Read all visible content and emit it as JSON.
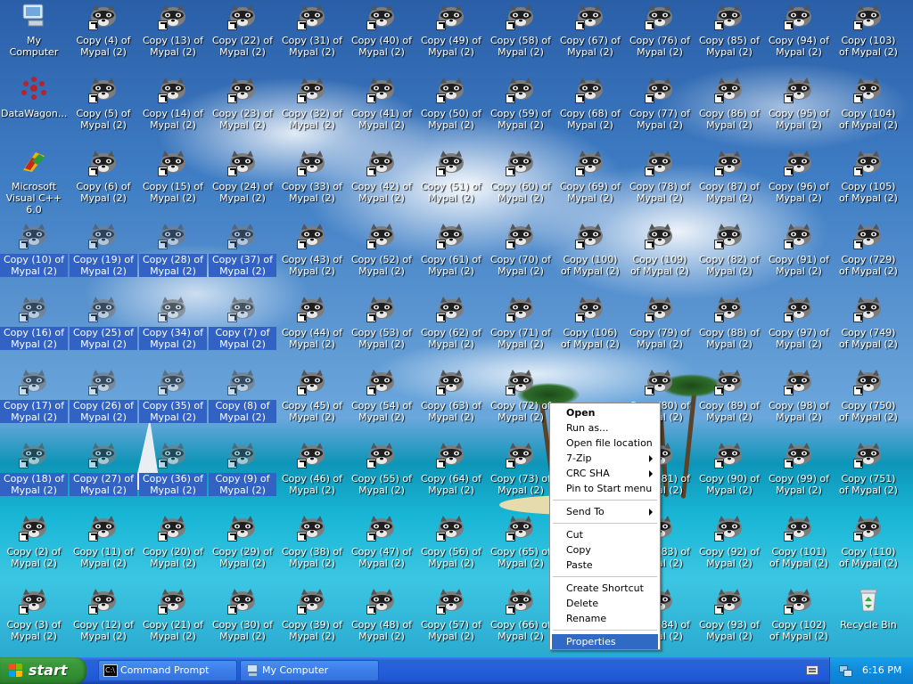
{
  "desktop": {
    "special_icons": [
      {
        "id": "my-computer",
        "label": "My Computer",
        "icon": "my-computer-icon"
      },
      {
        "id": "datawagon",
        "label": "DataWagon...",
        "icon": "datawagon-icon"
      },
      {
        "id": "msvc",
        "label": "Microsoft Visual C++ 6.0",
        "icon": "visual-cpp-icon"
      },
      {
        "id": "recycle-bin",
        "label": "Recycle Bin",
        "icon": "recycle-bin-icon"
      }
    ],
    "columns": [
      [
        "My Computer",
        "DataWagon...",
        "Microsoft Visual C++ 6.0",
        "Copy (10) of Mypal (2)",
        "Copy (16) of Mypal (2)",
        "Copy (17) of Mypal (2)",
        "Copy (18) of Mypal (2)",
        "Copy (2) of Mypal (2)",
        "Copy (3) of Mypal (2)"
      ],
      [
        "Copy (4) of Mypal (2)",
        "Copy (5) of Mypal (2)",
        "Copy (6) of Mypal (2)",
        "Copy (19) of Mypal (2)",
        "Copy (25) of Mypal (2)",
        "Copy (26) of Mypal (2)",
        "Copy (27) of Mypal (2)",
        "Copy (11) of Mypal (2)",
        "Copy (12) of Mypal (2)"
      ],
      [
        "Copy (13) of Mypal (2)",
        "Copy (14) of Mypal (2)",
        "Copy (15) of Mypal (2)",
        "Copy (28) of Mypal (2)",
        "Copy (34) of Mypal (2)",
        "Copy (35) of Mypal (2)",
        "Copy (36) of Mypal (2)",
        "Copy (20) of Mypal (2)",
        "Copy (21) of Mypal (2)"
      ],
      [
        "Copy (22) of Mypal (2)",
        "Copy (23) of Mypal (2)",
        "Copy (24) of Mypal (2)",
        "Copy (37) of Mypal (2)",
        "Copy (7) of Mypal (2)",
        "Copy (8) of Mypal (2)",
        "Copy (9) of Mypal (2)",
        "Copy (29) of Mypal (2)",
        "Copy (30) of Mypal (2)"
      ],
      [
        "Copy (31) of Mypal (2)",
        "Copy (32) of Mypal (2)",
        "Copy (33) of Mypal (2)",
        "Copy (43) of Mypal (2)",
        "Copy (44) of Mypal (2)",
        "Copy (45) of Mypal (2)",
        "Copy (46) of Mypal (2)",
        "Copy (38) of Mypal (2)",
        "Copy (39) of Mypal (2)"
      ],
      [
        "Copy (40) of Mypal (2)",
        "Copy (41) of Mypal (2)",
        "Copy (42) of Mypal (2)",
        "Copy (52) of Mypal (2)",
        "Copy (53) of Mypal (2)",
        "Copy (54) of Mypal (2)",
        "Copy (55) of Mypal (2)",
        "Copy (47) of Mypal (2)",
        "Copy (48) of Mypal (2)"
      ],
      [
        "Copy (49) of Mypal (2)",
        "Copy (50) of Mypal (2)",
        "Copy (51) of Mypal (2)",
        "Copy (61) of Mypal (2)",
        "Copy (62) of Mypal (2)",
        "Copy (63) of Mypal (2)",
        "Copy (64) of Mypal (2)",
        "Copy (56) of Mypal (2)",
        "Copy (57) of Mypal (2)"
      ],
      [
        "Copy (58) of Mypal (2)",
        "Copy (59) of Mypal (2)",
        "Copy (60) of Mypal (2)",
        "Copy (70) of Mypal (2)",
        "Copy (71) of Mypal (2)",
        "Copy (72) of Mypal (2)",
        "Copy (73) of Mypal (2)",
        "Copy (65) of Mypal (2)",
        "Copy (66) of Mypal (2)"
      ],
      [
        "Copy (67) of Mypal (2)",
        "Copy (68) of Mypal (2)",
        "Copy (69) of Mypal (2)",
        "Copy (100) of Mypal (2)",
        "Copy (106) of Mypal (2)",
        "",
        "",
        "",
        ""
      ],
      [
        "Copy (76) of Mypal (2)",
        "Copy (77) of Mypal (2)",
        "Copy (78) of Mypal (2)",
        "Copy (109) of Mypal (2)",
        "Copy (79) of Mypal (2)",
        "Copy (80) of Mypal (2)",
        "Copy (81) of Mypal (2)",
        "Copy (83) of Mypal (2)",
        "Copy (84) of Mypal (2)"
      ],
      [
        "Copy (85) of Mypal (2)",
        "Copy (86) of Mypal (2)",
        "Copy (87) of Mypal (2)",
        "Copy (82) of Mypal (2)",
        "Copy (88) of Mypal (2)",
        "Copy (89) of Mypal (2)",
        "Copy (90) of Mypal (2)",
        "Copy (92) of Mypal (2)",
        "Copy (93) of Mypal (2)"
      ],
      [
        "Copy (94) of Mypal (2)",
        "Copy (95) of Mypal (2)",
        "Copy (96) of Mypal (2)",
        "Copy (91) of Mypal (2)",
        "Copy (97) of Mypal (2)",
        "Copy (98) of Mypal (2)",
        "Copy (99) of Mypal (2)",
        "Copy (101) of Mypal (2)",
        "Copy (102) of Mypal (2)"
      ],
      [
        "Copy (103) of Mypal (2)",
        "Copy (104) of Mypal (2)",
        "Copy (105) of Mypal (2)",
        "Copy (729) of Mypal (2)",
        "Copy (749) of Mypal (2)",
        "Copy (750) of Mypal (2)",
        "Copy (751) of Mypal (2)",
        "Copy (110) of Mypal (2)",
        "Recycle Bin"
      ]
    ],
    "selected_labels": [
      "Copy (10) of Mypal (2)",
      "Copy (19) of Mypal (2)",
      "Copy (28) of Mypal (2)",
      "Copy (37) of Mypal (2)",
      "Copy (16) of Mypal (2)",
      "Copy (25) of Mypal (2)",
      "Copy (34) of Mypal (2)",
      "Copy (7) of Mypal (2)",
      "Copy (17) of Mypal (2)",
      "Copy (26) of Mypal (2)",
      "Copy (35) of Mypal (2)",
      "Copy (8) of Mypal (2)",
      "Copy (18) of Mypal (2)",
      "Copy (27) of Mypal (2)",
      "Copy (36) of Mypal (2)",
      "Copy (9) of Mypal (2)"
    ]
  },
  "context_menu": {
    "groups": [
      [
        {
          "label": "Open",
          "bold": true
        },
        {
          "label": "Run as..."
        },
        {
          "label": "Open file location"
        },
        {
          "label": "7-Zip",
          "submenu": true
        },
        {
          "label": "CRC SHA",
          "submenu": true
        },
        {
          "label": "Pin to Start menu"
        }
      ],
      [
        {
          "label": "Send To",
          "submenu": true
        }
      ],
      [
        {
          "label": "Cut"
        },
        {
          "label": "Copy"
        },
        {
          "label": "Paste"
        }
      ],
      [
        {
          "label": "Create Shortcut"
        },
        {
          "label": "Delete"
        },
        {
          "label": "Rename"
        }
      ],
      [
        {
          "label": "Properties",
          "highlighted": true
        }
      ]
    ]
  },
  "taskbar": {
    "start_label": "start",
    "tasks": [
      {
        "label": "Command Prompt",
        "icon": "command-prompt-icon"
      },
      {
        "label": "My Computer",
        "icon": "my-computer-icon"
      }
    ],
    "clock": "6:16 PM"
  },
  "colors": {
    "selection": "#3162c4",
    "menu_highlight": "#316ac5",
    "taskbar": "#245edb",
    "start_button": "#3c9a3c",
    "tray": "#0f8bdb"
  }
}
